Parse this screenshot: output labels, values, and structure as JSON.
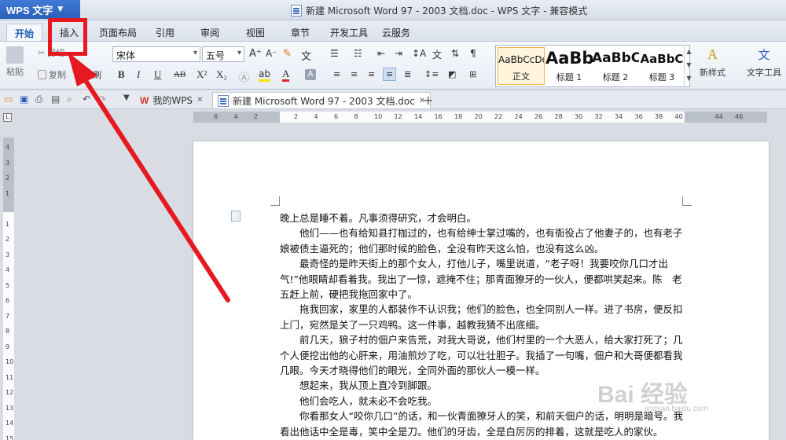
{
  "titlebar": {
    "app_name": "WPS 文字",
    "doc_title": "新建 Microsoft Word 97 - 2003 文档.doc - WPS 文字 - 兼容模式"
  },
  "menu_tabs": [
    "开始",
    "插入",
    "页面布局",
    "引用",
    "审阅",
    "视图",
    "章节",
    "开发工具",
    "云服务"
  ],
  "ribbon": {
    "paste": "粘贴",
    "cut": "剪切",
    "copy": "复制",
    "format_painter": "格式刷",
    "font_name": "宋体",
    "font_size": "五号",
    "bold": "B",
    "italic": "I",
    "underline": "U",
    "strikethrough": "AB",
    "superscript": "X²",
    "subscript": "X₂",
    "font_color": "A",
    "styles": [
      {
        "preview": "AaBbCcDd",
        "label": "正文"
      },
      {
        "preview": "AaBb",
        "label": "标题 1"
      },
      {
        "preview": "AaBbC",
        "label": "标题 2"
      },
      {
        "preview": "AaBbC",
        "label": "标题 3"
      }
    ],
    "new_style": "新样式",
    "text_tools": "文字工具"
  },
  "doc_tabs": {
    "my_wps": "我的WPS",
    "current_doc": "新建 Microsoft Word 97 - 2003 文档.doc"
  },
  "ruler": {
    "h_ticks": [
      "6",
      "4",
      "2",
      "",
      "2",
      "4",
      "6",
      "8",
      "10",
      "12",
      "14",
      "16",
      "18",
      "20",
      "22",
      "24",
      "26",
      "28",
      "30",
      "32",
      "34",
      "36",
      "38",
      "40",
      "",
      "44",
      "46"
    ],
    "v_ticks": [
      "4",
      "3",
      "2",
      "1",
      "",
      "1",
      "2",
      "3",
      "4",
      "5",
      "6",
      "7",
      "8",
      "9",
      "10",
      "11",
      "12",
      "13",
      "14",
      "15"
    ]
  },
  "document": {
    "paragraphs": [
      "晚上总是睡不着。凡事须得研究，才会明白。",
      "他们——也有给知县打枷过的，也有给绅士掌过嘴的，也有衙役占了他妻子的，也有老子娘被债主逼死的；他们那时候的脸色，全没有昨天这么怕，也没有这么凶。",
      "最奇怪的是昨天街上的那个女人，打他儿子，嘴里说道，“老子呀！我要咬你几口才出气!”他眼睛却看着我。我出了一惊，遮掩不住；那青面獠牙的一伙人，便都哄笑起来。陈　老五赶上前，硬把我拖回家中了。",
      "拖我回家，家里的人都装作不认识我；他们的脸色，也全同别人一样。进了书房，便反扣上门，宛然是关了一只鸡鸭。这一件事，越教我猜不出底细。",
      "前几天，狼子村的佃户来告荒，对我大哥说，他们村里的一个大恶人，给大家打死了；几个人便挖出他的心肝来，用油煎炒了吃，可以壮壮胆子。我插了一句嘴，佃户和大哥便都看我几眼。今天才晓得他们的眼光，全同外面的那伙人一模一样。",
      "想起来，我从顶上直冷到脚跟。",
      "他们会吃人，就未必不会吃我。",
      "你看那女人“咬你几口”的话，和一伙青面獠牙人的笑，和前天佃户的话，明明是暗号。我看出他话中全是毒，笑中全是刀。他们的牙齿，全是白厉厉的排着，这就是吃人的家伙。"
    ]
  },
  "watermark": {
    "text": "Bai 经验",
    "sub": "jingyan.baidu.com"
  },
  "colors": {
    "app_blue": "#2a5fb8",
    "annotation_red": "#e5191f"
  }
}
